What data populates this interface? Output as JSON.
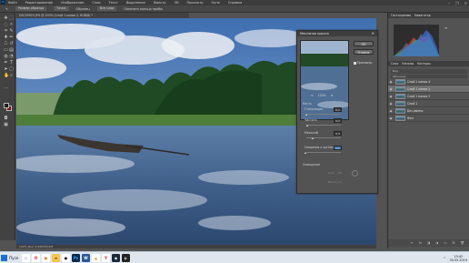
{
  "app": {
    "logo_text": "Ps",
    "menu": [
      "Файл",
      "Редактирование",
      "Изображение",
      "Слои",
      "Текст",
      "Выделение",
      "Фильтр",
      "3D",
      "Просмотр",
      "Окно",
      "Справка"
    ],
    "window_controls": [
      "–",
      "❐",
      "✕"
    ]
  },
  "options_bar": {
    "items": [
      "Размер образца",
      "Точка",
      "Образец",
      "Все слои",
      "Показать кольцо пробы"
    ]
  },
  "document_tab": {
    "title": "DSC05925.JPG @ 100% (Слой 1 копия 2, RGB/8) *"
  },
  "dialog": {
    "title": "Масляная краска",
    "ok_label": "ОК",
    "cancel_label": "Отмена",
    "preview_label": "Просмотр",
    "preview_checked": true,
    "zoom_out": "⊖",
    "zoom_level": "100%",
    "zoom_in": "⊕",
    "brush_section": "Кисть",
    "params": [
      {
        "label": "Стилизация",
        "value": "0,1",
        "level": 0.02
      },
      {
        "label": "Чистота",
        "value": "0,4",
        "level": 0.04
      },
      {
        "label": "Масштаб",
        "value": "2,3",
        "level": 0.2
      },
      {
        "label": "Сведения о щетине",
        "value": "0,0",
        "level": 0.0
      }
    ],
    "lighting_section": "Освещение",
    "angle_label": "Угол",
    "angle_value": "-60",
    "shine_label": "Блеск",
    "shine_value": "1,3"
  },
  "panels": {
    "top_tabs": [
      "Гистограмма",
      "Навигатор"
    ],
    "layers_tabs": [
      "Слои",
      "Каналы",
      "Контуры"
    ],
    "layer_filter": "Вид",
    "layer_blend": "Обычные",
    "layers": [
      {
        "name": "Слой 1 копия 4",
        "active": false
      },
      {
        "name": "Слой 1 копия 2",
        "active": true
      },
      {
        "name": "Слой 1 копия 3",
        "active": false
      },
      {
        "name": "Слой 1",
        "active": false
      },
      {
        "name": "Без имени",
        "active": false
      },
      {
        "name": "Фон",
        "active": false
      }
    ],
    "footer_icons": [
      "link-icon",
      "fx-icon",
      "mask-icon",
      "adjustment-icon",
      "folder-icon",
      "new-layer-icon",
      "trash-icon"
    ]
  },
  "status": {
    "text": "100%   Док: 2,64М/18,5М"
  },
  "taskbar": {
    "start_label": "Пуск",
    "apps": [
      {
        "name": "cortana",
        "glyph": "○",
        "bg": "#ffffff",
        "fg": "#5b4bd1"
      },
      {
        "name": "opera",
        "glyph": "O",
        "bg": "#ffffff",
        "fg": "#d8101f"
      },
      {
        "name": "firefox",
        "glyph": "●",
        "bg": "#ffffff",
        "fg": "#ff7a10"
      },
      {
        "name": "explorer",
        "glyph": "▰",
        "bg": "#f4c64b",
        "fg": "#8a5a00"
      },
      {
        "name": "recorder",
        "glyph": "●",
        "bg": "#ffffff",
        "fg": "#1a1a1a"
      },
      {
        "name": "photoshop",
        "glyph": "Ps",
        "bg": "#0c2a4a",
        "fg": "#31a8ff"
      },
      {
        "name": "word",
        "glyph": "W",
        "bg": "#2b5797",
        "fg": "#ffffff"
      },
      {
        "name": "vlc",
        "glyph": "▲",
        "bg": "#ffffff",
        "fg": "#ff8800"
      },
      {
        "name": "yandex",
        "glyph": "Y",
        "bg": "#ffffff",
        "fg": "#e61400"
      },
      {
        "name": "steam",
        "glyph": "◉",
        "bg": "#1b2838",
        "fg": "#ffffff"
      },
      {
        "name": "camera",
        "glyph": "◐",
        "bg": "#222222",
        "fg": "#dddddd"
      }
    ],
    "time": "13:42",
    "date": "03.05.2019",
    "tray_arrow": "^"
  },
  "colors": {
    "accent": "#3a6fb0",
    "bg_panel": "#535353",
    "fg_swatch": "#1a1a1a",
    "bg_swatch": "#7a1414"
  }
}
